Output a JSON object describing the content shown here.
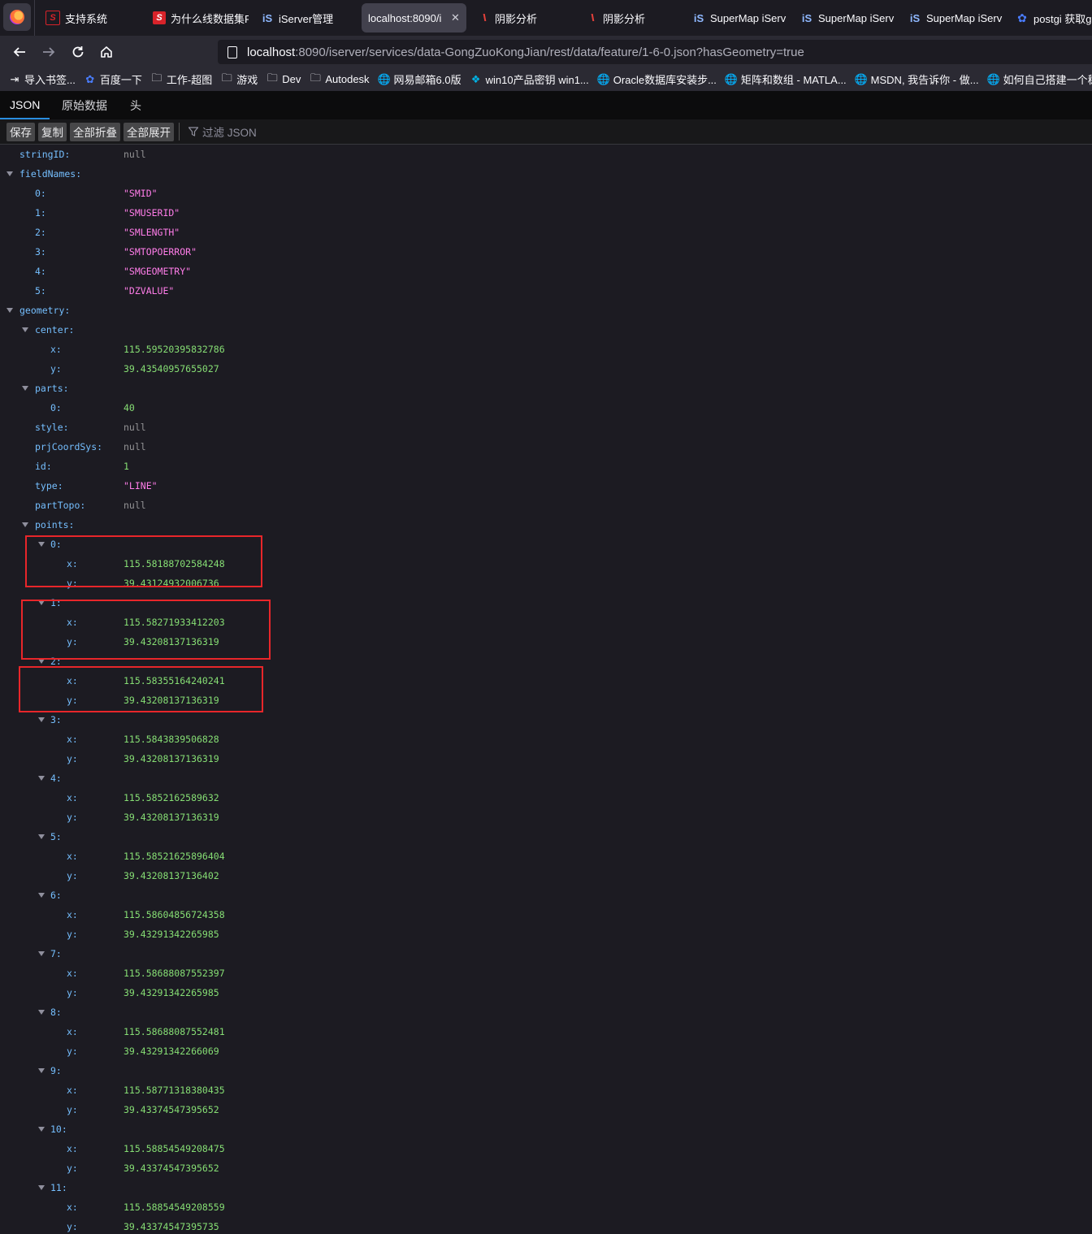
{
  "browser": {
    "tabs": [
      {
        "title": "支持系统",
        "icon": "supermap-support-icon",
        "active": false
      },
      {
        "title": "为什么线数据集F",
        "icon": "supermap-s-icon",
        "active": false
      },
      {
        "title": "iServer管理",
        "icon": "iserver-icon",
        "active": false
      },
      {
        "title": "localhost:8090/i",
        "icon": "",
        "active": true,
        "close": "✕"
      },
      {
        "title": "阴影分析",
        "icon": "wave-icon",
        "active": false
      },
      {
        "title": "阴影分析",
        "icon": "wave-icon",
        "active": false
      },
      {
        "title": "SuperMap iServ",
        "icon": "iserver-icon",
        "active": false
      },
      {
        "title": "SuperMap iServ",
        "icon": "iserver-icon",
        "active": false
      },
      {
        "title": "SuperMap iServ",
        "icon": "iserver-icon",
        "active": false
      },
      {
        "title": "postgi 获取g",
        "icon": "baidu-paw-icon",
        "active": false
      }
    ],
    "url": {
      "host": "localhost",
      "rest": ":8090/iserver/services/data-GongZuoKongJian/rest/data/feature/1-6-0.json?hasGeometry=true"
    },
    "bookmarks": [
      {
        "label": "导入书签...",
        "icon": "import-icon"
      },
      {
        "label": "百度一下",
        "icon": "baidu-paw-icon"
      },
      {
        "label": "工作-超图",
        "icon": "folder-icon"
      },
      {
        "label": "游戏",
        "icon": "folder-icon"
      },
      {
        "label": "Dev",
        "icon": "folder-icon"
      },
      {
        "label": "Autodesk",
        "icon": "folder-icon"
      },
      {
        "label": "网易邮箱6.0版",
        "icon": "globe-icon"
      },
      {
        "label": "win10产品密钥 win1...",
        "icon": "windows-logo-icon"
      },
      {
        "label": "Oracle数据库安装步...",
        "icon": "globe-icon"
      },
      {
        "label": "矩阵和数组 - MATLA...",
        "icon": "globe-icon"
      },
      {
        "label": "MSDN, 我告诉你 - 做...",
        "icon": "globe-icon"
      },
      {
        "label": "如何自己搭建一个稳...",
        "icon": "globe-icon"
      }
    ]
  },
  "viewer": {
    "tabs": [
      "JSON",
      "原始数据",
      "头"
    ],
    "active_tab": "JSON",
    "toolbar": {
      "save": "保存",
      "copy": "复制",
      "collapse_all": "全部折叠",
      "expand_all": "全部展开",
      "filter_placeholder": "过滤 JSON"
    }
  },
  "json_rows": [
    {
      "key": "stringID:",
      "value": "null",
      "kind": "null",
      "depth": 0,
      "twisty": false
    },
    {
      "key": "fieldNames:",
      "value": "",
      "kind": "",
      "depth": 0,
      "twisty": true
    },
    {
      "key": "0:",
      "value": "\"SMID\"",
      "kind": "str",
      "depth": 1,
      "twisty": false
    },
    {
      "key": "1:",
      "value": "\"SMUSERID\"",
      "kind": "str",
      "depth": 1,
      "twisty": false
    },
    {
      "key": "2:",
      "value": "\"SMLENGTH\"",
      "kind": "str",
      "depth": 1,
      "twisty": false
    },
    {
      "key": "3:",
      "value": "\"SMTOPOERROR\"",
      "kind": "str",
      "depth": 1,
      "twisty": false
    },
    {
      "key": "4:",
      "value": "\"SMGEOMETRY\"",
      "kind": "str",
      "depth": 1,
      "twisty": false
    },
    {
      "key": "5:",
      "value": "\"DZVALUE\"",
      "kind": "str",
      "depth": 1,
      "twisty": false
    },
    {
      "key": "geometry:",
      "value": "",
      "kind": "",
      "depth": 0,
      "twisty": true
    },
    {
      "key": "center:",
      "value": "",
      "kind": "",
      "depth": 1,
      "twisty": true
    },
    {
      "key": "x:",
      "value": "115.59520395832786",
      "kind": "num",
      "depth": 2,
      "twisty": false
    },
    {
      "key": "y:",
      "value": "39.43540957655027",
      "kind": "num",
      "depth": 2,
      "twisty": false
    },
    {
      "key": "parts:",
      "value": "",
      "kind": "",
      "depth": 1,
      "twisty": true
    },
    {
      "key": "0:",
      "value": "40",
      "kind": "num",
      "depth": 2,
      "twisty": false
    },
    {
      "key": "style:",
      "value": "null",
      "kind": "null",
      "depth": 1,
      "twisty": false
    },
    {
      "key": "prjCoordSys:",
      "value": "null",
      "kind": "null",
      "depth": 1,
      "twisty": false
    },
    {
      "key": "id:",
      "value": "1",
      "kind": "num",
      "depth": 1,
      "twisty": false
    },
    {
      "key": "type:",
      "value": "\"LINE\"",
      "kind": "str",
      "depth": 1,
      "twisty": false
    },
    {
      "key": "partTopo:",
      "value": "null",
      "kind": "null",
      "depth": 1,
      "twisty": false
    },
    {
      "key": "points:",
      "value": "",
      "kind": "",
      "depth": 1,
      "twisty": true
    },
    {
      "key": "0:",
      "value": "",
      "kind": "",
      "depth": 2,
      "twisty": true
    },
    {
      "key": "x:",
      "value": "115.58188702584248",
      "kind": "num",
      "depth": 3,
      "twisty": false
    },
    {
      "key": "y:",
      "value": "39.43124932006736",
      "kind": "num",
      "depth": 3,
      "twisty": false
    },
    {
      "key": "1:",
      "value": "",
      "kind": "",
      "depth": 2,
      "twisty": true
    },
    {
      "key": "x:",
      "value": "115.58271933412203",
      "kind": "num",
      "depth": 3,
      "twisty": false
    },
    {
      "key": "y:",
      "value": "39.43208137136319",
      "kind": "num",
      "depth": 3,
      "twisty": false
    },
    {
      "key": "2:",
      "value": "",
      "kind": "",
      "depth": 2,
      "twisty": true
    },
    {
      "key": "x:",
      "value": "115.58355164240241",
      "kind": "num",
      "depth": 3,
      "twisty": false
    },
    {
      "key": "y:",
      "value": "39.43208137136319",
      "kind": "num",
      "depth": 3,
      "twisty": false
    },
    {
      "key": "3:",
      "value": "",
      "kind": "",
      "depth": 2,
      "twisty": true
    },
    {
      "key": "x:",
      "value": "115.5843839506828",
      "kind": "num",
      "depth": 3,
      "twisty": false
    },
    {
      "key": "y:",
      "value": "39.43208137136319",
      "kind": "num",
      "depth": 3,
      "twisty": false
    },
    {
      "key": "4:",
      "value": "",
      "kind": "",
      "depth": 2,
      "twisty": true
    },
    {
      "key": "x:",
      "value": "115.5852162589632",
      "kind": "num",
      "depth": 3,
      "twisty": false
    },
    {
      "key": "y:",
      "value": "39.43208137136319",
      "kind": "num",
      "depth": 3,
      "twisty": false
    },
    {
      "key": "5:",
      "value": "",
      "kind": "",
      "depth": 2,
      "twisty": true
    },
    {
      "key": "x:",
      "value": "115.58521625896404",
      "kind": "num",
      "depth": 3,
      "twisty": false
    },
    {
      "key": "y:",
      "value": "39.43208137136402",
      "kind": "num",
      "depth": 3,
      "twisty": false
    },
    {
      "key": "6:",
      "value": "",
      "kind": "",
      "depth": 2,
      "twisty": true
    },
    {
      "key": "x:",
      "value": "115.58604856724358",
      "kind": "num",
      "depth": 3,
      "twisty": false
    },
    {
      "key": "y:",
      "value": "39.43291342265985",
      "kind": "num",
      "depth": 3,
      "twisty": false
    },
    {
      "key": "7:",
      "value": "",
      "kind": "",
      "depth": 2,
      "twisty": true
    },
    {
      "key": "x:",
      "value": "115.58688087552397",
      "kind": "num",
      "depth": 3,
      "twisty": false
    },
    {
      "key": "y:",
      "value": "39.43291342265985",
      "kind": "num",
      "depth": 3,
      "twisty": false
    },
    {
      "key": "8:",
      "value": "",
      "kind": "",
      "depth": 2,
      "twisty": true
    },
    {
      "key": "x:",
      "value": "115.58688087552481",
      "kind": "num",
      "depth": 3,
      "twisty": false
    },
    {
      "key": "y:",
      "value": "39.43291342266069",
      "kind": "num",
      "depth": 3,
      "twisty": false
    },
    {
      "key": "9:",
      "value": "",
      "kind": "",
      "depth": 2,
      "twisty": true
    },
    {
      "key": "x:",
      "value": "115.58771318380435",
      "kind": "num",
      "depth": 3,
      "twisty": false
    },
    {
      "key": "y:",
      "value": "39.43374547395652",
      "kind": "num",
      "depth": 3,
      "twisty": false
    },
    {
      "key": "10:",
      "value": "",
      "kind": "",
      "depth": 2,
      "twisty": true
    },
    {
      "key": "x:",
      "value": "115.58854549208475",
      "kind": "num",
      "depth": 3,
      "twisty": false
    },
    {
      "key": "y:",
      "value": "39.43374547395652",
      "kind": "num",
      "depth": 3,
      "twisty": false
    },
    {
      "key": "11:",
      "value": "",
      "kind": "",
      "depth": 2,
      "twisty": true
    },
    {
      "key": "x:",
      "value": "115.58854549208559",
      "kind": "num",
      "depth": 3,
      "twisty": false
    },
    {
      "key": "y:",
      "value": "39.43374547395735",
      "kind": "num",
      "depth": 3,
      "twisty": false
    }
  ],
  "colors": {
    "key": "#75bfff",
    "number": "#86de74",
    "string": "#ff7de9",
    "null": "#939395",
    "highlight": "#e8262a"
  }
}
